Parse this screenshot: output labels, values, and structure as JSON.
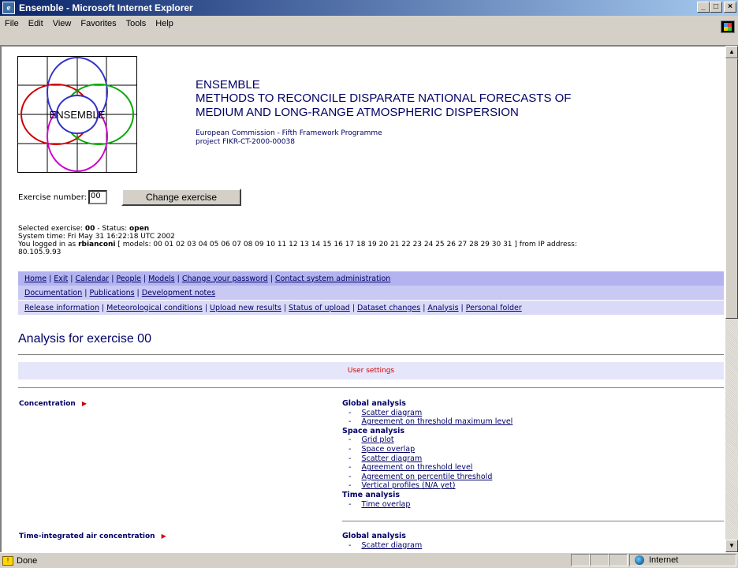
{
  "window": {
    "title": "Ensemble - Microsoft Internet Explorer",
    "controls": [
      "_",
      "□",
      "×"
    ]
  },
  "menu": [
    "File",
    "Edit",
    "View",
    "Favorites",
    "Tools",
    "Help"
  ],
  "header": {
    "logo_text": "ENSEMBLE",
    "title": "ENSEMBLE",
    "subtitle_line1": "METHODS TO RECONCILE DISPARATE NATIONAL FORECASTS OF",
    "subtitle_line2": "MEDIUM AND LONG-RANGE ATMOSPHERIC DISPERSION",
    "org_line1": "European Commission - Fifth Framework Programme",
    "org_line2": "project FIKR-CT-2000-00038"
  },
  "exercise": {
    "label": "Exercise number:",
    "value": "00",
    "button": "Change exercise"
  },
  "info": {
    "selected_prefix": "Selected exercise: ",
    "selected_value": "00",
    "status_prefix": " - Status: ",
    "status_value": "open",
    "system_time": "System time: Fri May 31 16:22:18 UTC 2002",
    "login_prefix": "You logged in as ",
    "login_user": "rbianconi",
    "login_models": " [ models: 00 01 02 03 04 05 06 07 08 09 10 11 12 13 14 15 16 17 18 19 20 21 22 23 24 25 26 27 28 29 30 31 ] from IP address:",
    "ip": "80.105.9.93"
  },
  "nav": {
    "row1": [
      "Home",
      "Exit",
      "Calendar",
      "People",
      "Models",
      "Change your password",
      "Contact system administration"
    ],
    "row2": [
      "Documentation",
      "Publications",
      "Development notes"
    ],
    "row3": [
      "Release information",
      "Meteorological conditions",
      "Upload new results",
      "Status of upload",
      "Dataset changes",
      "Analysis",
      "Personal folder"
    ]
  },
  "page_title": "Analysis for exercise 00",
  "user_settings": "User settings",
  "sections": [
    {
      "label": "Concentration",
      "groups": [
        {
          "name": "Global analysis",
          "items": [
            "Scatter diagram",
            "Agreement on threshold maximum level"
          ]
        },
        {
          "name": "Space analysis",
          "items": [
            "Grid plot",
            "Space overlap",
            "Scatter diagram",
            "Agreement on threshold level",
            "Agreement on percentile threshold",
            "Vertical profiles (N/A yet)"
          ]
        },
        {
          "name": "Time analysis",
          "items": [
            "Time overlap"
          ]
        }
      ]
    },
    {
      "label": "Time-integrated air concentration",
      "groups": [
        {
          "name": "Global analysis",
          "items": [
            "Scatter diagram"
          ]
        }
      ]
    }
  ],
  "status": {
    "text": "Done",
    "zone": "Internet"
  }
}
